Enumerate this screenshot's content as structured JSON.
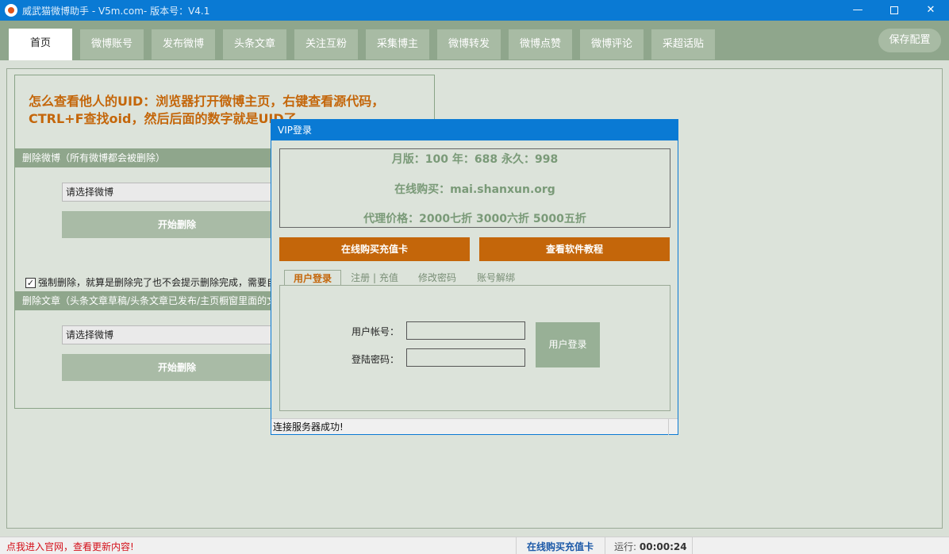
{
  "window": {
    "title": "威武猫微博助手 - V5m.com- 版本号：V4.1"
  },
  "tabs": [
    "首页",
    "微博账号",
    "发布微博",
    "头条文章",
    "关注互粉",
    "采集博主",
    "微博转发",
    "微博点赞",
    "微博评论",
    "采超话贴"
  ],
  "header": {
    "save_label": "保存配置"
  },
  "main": {
    "info_line1": "怎么查看他人的UID：浏览器打开微博主页，右键查看源代码，",
    "info_line2": "CTRL+F查找oid，然后后面的数字就是UID了",
    "section1_title": "删除微博（所有微博都会被删除）",
    "section1_select": "请选择微博",
    "section1_button": "开始删除",
    "force_delete_label": "强制删除，就算是删除完了也不会提示删除完成，需要自",
    "section2_title": "删除文章（头条文章草稿/头条文章已发布/主页橱窗里面的文",
    "section2_select": "请选择微博",
    "section2_button": "开始删除"
  },
  "dialog": {
    "title": "VIP登录",
    "price_line": "月版：100 年：688 永久：998",
    "buy_online_line": "在线购买：mai.shanxun.org",
    "agent_line": "代理价格：2000七折 3000六折 5000五折",
    "buy_card_button": "在线购买充值卡",
    "tutorial_button": "查看软件教程",
    "tabs": [
      "用户登录",
      "注册 | 充值",
      "修改密码",
      "账号解绑"
    ],
    "account_label": "用户帐号：",
    "password_label": "登陆密码：",
    "login_button": "用户登录",
    "status": "连接服务器成功!"
  },
  "statusbar": {
    "link_text": "点我进入官网，查看更新内容!",
    "buy_card": "在线购买充值卡",
    "run_label": "运行:",
    "run_time": "00:00:24"
  },
  "colors": {
    "title_blue": "#0a7ad4",
    "header_green": "#8fa68c",
    "accent_orange": "#c4660a",
    "status_red": "#d4101a"
  }
}
